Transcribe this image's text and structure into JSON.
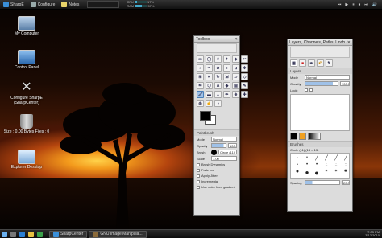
{
  "topbar": {
    "items": [
      {
        "label": "SharpE"
      },
      {
        "label": "Configure"
      },
      {
        "label": "Notes"
      }
    ],
    "cpu_label": "CPU",
    "cpu_value": "17%",
    "cpu_level": 0.17,
    "ram_label": "RAM",
    "ram_value": "57%",
    "ram_level": 0.57
  },
  "desktop_icons": [
    {
      "label": "My Computer",
      "icon": "computer-icon"
    },
    {
      "label": "Control Panel",
      "icon": "control-panel-icon"
    },
    {
      "label": "Configure SharpE (SharpCenter)",
      "icon": "tools-icon"
    },
    {
      "label": "Size : 0.00 Bytes Files : 0",
      "icon": "recycle-bin-icon"
    },
    {
      "label": "Explorer Desktop",
      "icon": "explorer-icon"
    }
  ],
  "toolbox": {
    "title": "Toolbox",
    "paintbrush_header": "Paintbrush",
    "mode_label": "Mode",
    "mode_value": "Normal",
    "opacity_label": "Opacity",
    "opacity_value": "100.0",
    "brush_label": "Brush",
    "brush_value": "Circle (11)",
    "scale_label": "Scale",
    "scale_value": "1.00",
    "options": [
      "Brush Dynamics",
      "Fade out",
      "Apply Jitter",
      "Incremental",
      "Use color from gradient"
    ]
  },
  "layers": {
    "title": "Layers, Channels, Paths, Undo - Bru",
    "section": "Layers",
    "mode_label": "Mode",
    "mode_value": "Normal",
    "opacity_label": "Opacity",
    "opacity_value": "100.0",
    "lock_label": "Lock:",
    "brushes_label": "Brushes",
    "brush_name": "Circle (11) (13 × 13)",
    "spacing_label": "Spacing",
    "spacing_value": "20.0"
  },
  "taskbar": {
    "tasks": [
      {
        "label": "SharpCenter"
      },
      {
        "label": "GNU Image Manipula..."
      }
    ],
    "time": "7:03 PM",
    "date": "3/12/2010"
  }
}
